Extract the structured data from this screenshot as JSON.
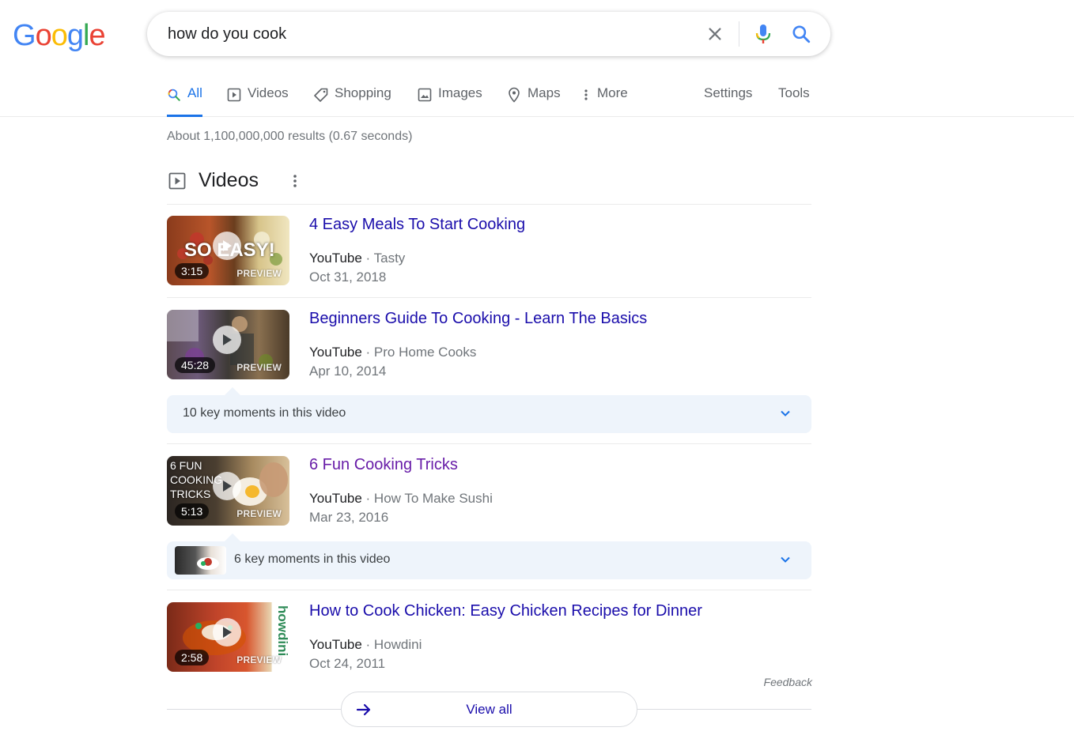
{
  "logo": {
    "letters": [
      "G",
      "o",
      "o",
      "g",
      "l",
      "e"
    ],
    "colors": [
      "#4285f4",
      "#ea4335",
      "#fbbc05",
      "#4285f4",
      "#34a853",
      "#ea4335"
    ]
  },
  "search": {
    "query": "how do you cook",
    "clear_icon": "close-icon",
    "mic_icon": "mic-icon",
    "search_icon": "search-icon"
  },
  "tabs": [
    {
      "label": "All",
      "icon": "search-icon",
      "active": true
    },
    {
      "label": "Videos",
      "icon": "play-icon"
    },
    {
      "label": "Shopping",
      "icon": "tag-icon"
    },
    {
      "label": "Images",
      "icon": "image-icon"
    },
    {
      "label": "Maps",
      "icon": "map-pin-icon"
    },
    {
      "label": "More",
      "icon": "more-vert-icon"
    }
  ],
  "tools": {
    "settings": "Settings",
    "tools": "Tools"
  },
  "result_stats": "About 1,100,000,000 results (0.67 seconds)",
  "videos": {
    "heading": "Videos",
    "preview_label": "PREVIEW",
    "items": [
      {
        "title": "4 Easy Meals To Start Cooking",
        "platform": "YouTube",
        "channel": "Tasty",
        "date": "Oct 31, 2018",
        "duration": "3:15",
        "overlay_text": "SO EASY!"
      },
      {
        "title": "Beginners Guide To Cooking - Learn The Basics",
        "platform": "YouTube",
        "channel": "Pro Home Cooks",
        "date": "Apr 10, 2014",
        "duration": "45:28",
        "key_moments": "10 key moments in this video"
      },
      {
        "title": "6 Fun Cooking Tricks",
        "platform": "YouTube",
        "channel": "How To Make Sushi",
        "date": "Mar 23, 2016",
        "duration": "5:13",
        "overlay_text": "6 FUN COOKING TRICKS",
        "key_moments": "6 key moments in this video",
        "visited": true
      },
      {
        "title": "How to Cook Chicken: Easy Chicken Recipes for Dinner",
        "platform": "YouTube",
        "channel": "Howdini",
        "date": "Oct 24, 2011",
        "duration": "2:58",
        "overlay_text": "howdini"
      }
    ],
    "separator": " · ",
    "feedback": "Feedback",
    "view_all": "View all"
  }
}
